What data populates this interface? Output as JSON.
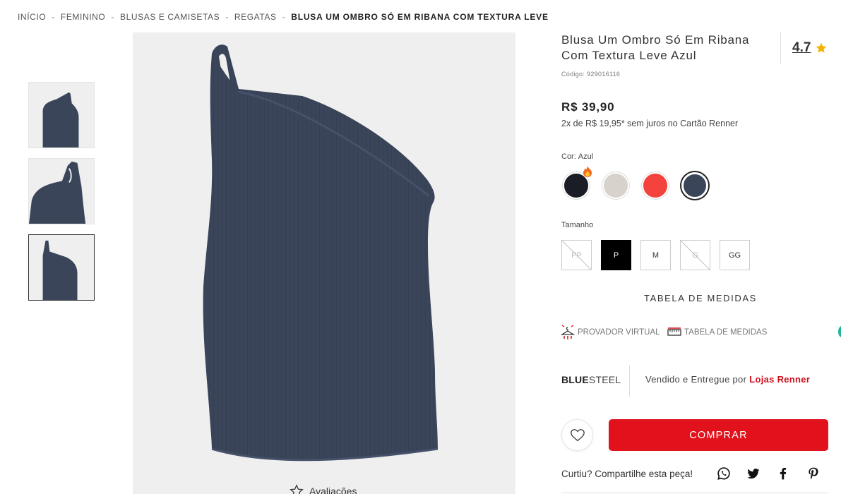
{
  "breadcrumb": {
    "items": [
      "INÍCIO",
      "FEMININO",
      "BLUSAS E CAMISETAS",
      "REGATAS"
    ],
    "separator": "-",
    "current": "BLUSA UM OMBRO SÓ EM RIBANA COM TEXTURA LEVE"
  },
  "gallery": {
    "thumbnails": [
      "thumbnail-front",
      "thumbnail-side",
      "thumbnail-back"
    ],
    "active_index": 2,
    "reviews_label": "Avaliações"
  },
  "product": {
    "title": "Blusa Um Ombro Só Em Ribana Com Textura Leve Azul",
    "rating": "4.7",
    "code_label": "Código:",
    "code_value": "929016116",
    "price": "R$ 39,90",
    "installments": "2x de R$ 19,95* sem juros no Cartão Renner",
    "color_label": "Cor:",
    "color_value": "Azul",
    "colors": [
      {
        "name": "preto",
        "hex": "#1a1d26",
        "selected": false
      },
      {
        "name": "bege",
        "hex": "#d7d3cc",
        "selected": false
      },
      {
        "name": "vermelho",
        "hex": "#f4433d",
        "selected": false
      },
      {
        "name": "azul",
        "hex": "#3a455a",
        "selected": true
      }
    ],
    "size_label": "Tamanho",
    "sizes": [
      {
        "label": "PP",
        "available": false,
        "selected": false
      },
      {
        "label": "P",
        "available": true,
        "selected": true
      },
      {
        "label": "M",
        "available": true,
        "selected": false
      },
      {
        "label": "G",
        "available": false,
        "selected": false
      },
      {
        "label": "GG",
        "available": true,
        "selected": false
      }
    ],
    "size_chart_link": "TABELA DE MEDIDAS"
  },
  "tools": {
    "virtual_fitting": "PROVADOR VIRTUAL",
    "size_table": "TABELA DE MEDIDAS"
  },
  "seller": {
    "brand_part1": "BLUE",
    "brand_part2": "STEEL",
    "sold_by": "Vendido e Entregue por",
    "store": "Lojas Renner"
  },
  "actions": {
    "buy": "COMPRAR",
    "share_label": "Curtiu? Compartilhe esta peça!",
    "share_icons": [
      "whatsapp-icon",
      "twitter-icon",
      "facebook-icon",
      "pinterest-icon"
    ]
  },
  "colors": {
    "accent": "#e2121c",
    "store_link": "#d0101c",
    "star": "#f5b301",
    "garment": "#3a455a"
  }
}
